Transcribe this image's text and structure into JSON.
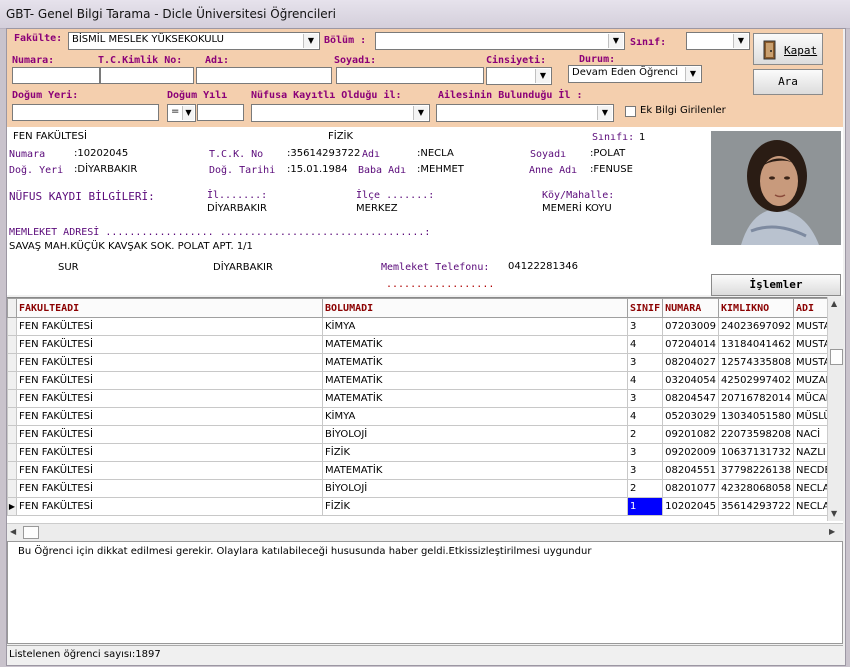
{
  "window": {
    "title": "GBT- Genel Bilgi Tarama - Dicle Üniversitesi Öğrencileri"
  },
  "filters": {
    "fakulte_label": "Fakülte:",
    "fakulte_value": "BİSMİL MESLEK YÜKSEKOKULU",
    "bolum_label": "Bölüm :",
    "bolum_value": "",
    "sinif_label": "Sınıf:",
    "sinif_value": "",
    "numara_label": "Numara:",
    "tc_label": "T.C.Kimlik No:",
    "adi_label": "Adı:",
    "soyadi_label": "Soyadı:",
    "cinsiyet_label": "Cinsiyeti:",
    "durum_label": "Durum:",
    "durum_value": "Devam Eden Öğrenci",
    "dogum_yeri_label": "Doğum Yeri:",
    "dogum_yili_label": "Doğum Yılı",
    "dogum_yili_op": "=",
    "nufus_label": "Nüfusa Kayıtlı Olduğu il:",
    "ailesinin_label": "Ailesinin Bulunduğu İl :",
    "ek_bilgi_label": "Ek Bilgi Girilenler",
    "kapat_label": "Kapat",
    "ara_label": "Ara"
  },
  "detail": {
    "fakulte": "FEN FAKÜLTESİ",
    "bolum": "FİZİK",
    "sinif_label": "Sınıfı:",
    "sinif": "1",
    "numara_label": "Numara",
    "numara": ":10202045",
    "tck_label": "T.C.K. No",
    "tck": ":35614293722",
    "adi_label": "Adı",
    "adi": ":NECLA",
    "soyadi_label": "Soyadı",
    "soyadi": ":POLAT",
    "dog_yeri_label": "Doğ. Yeri",
    "dog_yeri": ":DİYARBAKIR",
    "dog_tarihi_label": "Doğ. Tarihi",
    "dog_tarihi": ":15.01.1984",
    "baba_label": "Baba Adı",
    "baba": ":MEHMET",
    "anne_label": "Anne Adı",
    "anne": ":FENUSE",
    "nufus_title": "NÜFUS KAYDI BİLGİLERİ:",
    "il_label": "İl.......:",
    "il": "DİYARBAKIR",
    "ilce_label": "İlçe .......:",
    "ilce": "MERKEZ",
    "koy_label": "Köy/Mahalle:",
    "koy": "MEMERİ KOYU",
    "memleket_title": "MEMLEKET ADRESİ  .................. ..................................:",
    "adres": "SAVAŞ MAH.KÜÇÜK KAVŞAK SOK. POLAT APT. 1/1",
    "adres_ilce": "SUR",
    "adres_il": "DİYARBAKIR",
    "tel_label": "Memleket Telefonu:",
    "tel": "04122281346",
    "tel_dots": "..................",
    "islemler_label": "İşlemler"
  },
  "grid": {
    "columns": [
      "FAKULTEADI",
      "BOLUMADI",
      "SINIF",
      "NUMARA",
      "KIMLIKNO",
      "ADI"
    ],
    "rows": [
      [
        "FEN FAKÜLTESİ",
        "KİMYA",
        "3",
        "07203009",
        "24023697092",
        "MUSTAF"
      ],
      [
        "FEN FAKÜLTESİ",
        "MATEMATİK",
        "4",
        "07204014",
        "13184041462",
        "MUSTAF"
      ],
      [
        "FEN FAKÜLTESİ",
        "MATEMATİK",
        "3",
        "08204027",
        "12574335808",
        "MUSTAF"
      ],
      [
        "FEN FAKÜLTESİ",
        "MATEMATİK",
        "4",
        "03204054",
        "42502997402",
        "MUZAFF"
      ],
      [
        "FEN FAKÜLTESİ",
        "MATEMATİK",
        "3",
        "08204547",
        "20716782014",
        "MÜCAH"
      ],
      [
        "FEN FAKÜLTESİ",
        "KİMYA",
        "4",
        "05203029",
        "13034051580",
        "MÜSLÜM"
      ],
      [
        "FEN FAKÜLTESİ",
        "BİYOLOJİ",
        "2",
        "09201082",
        "22073598208",
        "NACİ"
      ],
      [
        "FEN FAKÜLTESİ",
        "FİZİK",
        "3",
        "09202009",
        "10637131732",
        "NAZLI"
      ],
      [
        "FEN FAKÜLTESİ",
        "MATEMATİK",
        "3",
        "08204551",
        "37798226138",
        "NECDET"
      ],
      [
        "FEN FAKÜLTESİ",
        "BİYOLOJİ",
        "2",
        "08201077",
        "42328068058",
        "NECLA"
      ],
      [
        "FEN FAKÜLTESİ",
        "FİZİK",
        "1",
        "10202045",
        "35614293722",
        "NECLA"
      ]
    ]
  },
  "note": "Bu Öğrenci için dikkat edilmesi gerekir. Olaylara katılabileceği hususunda haber geldi.Etkissizleştirilmesi uygundur",
  "status": "Listelenen öğrenci sayısı:1897",
  "colors": {
    "filter_bg": "#f4cfae",
    "label": "#8b0078",
    "selected": "#0000ff"
  }
}
